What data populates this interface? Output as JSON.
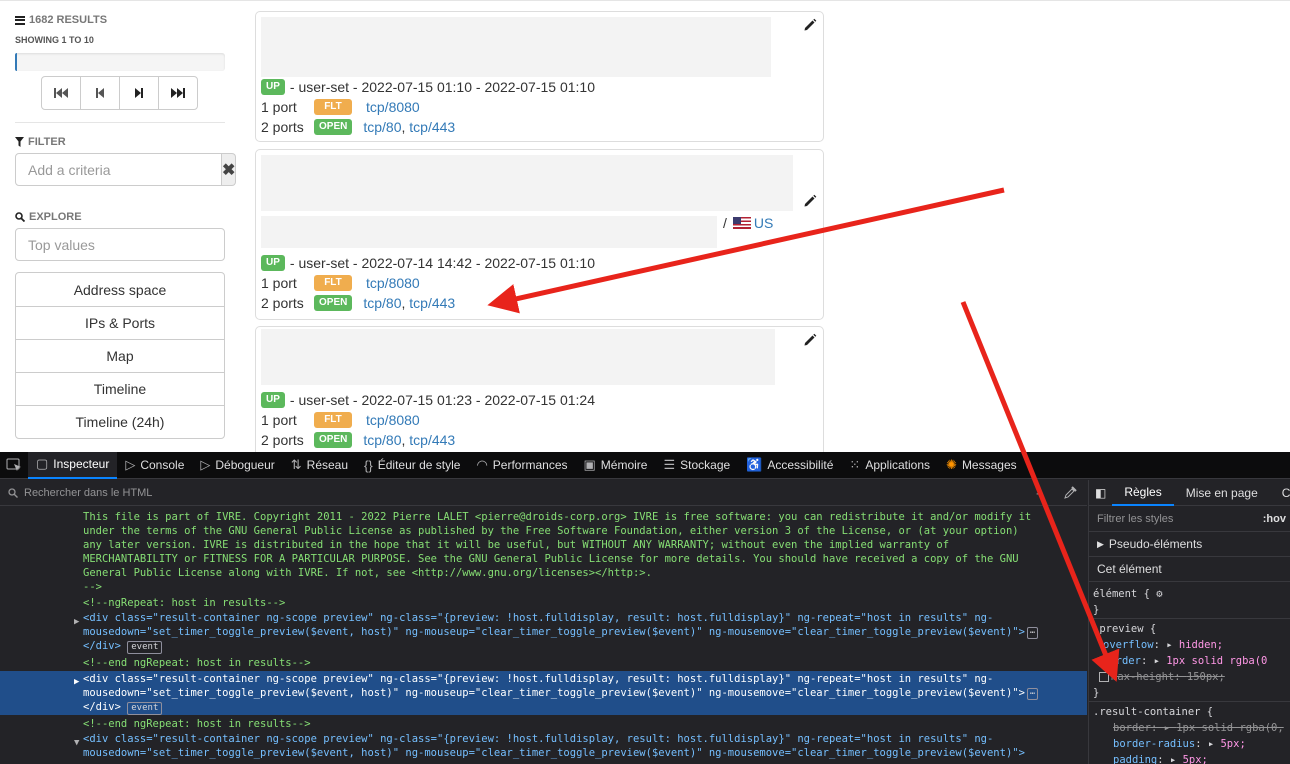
{
  "sidebar": {
    "results_count": "1682 RESULTS",
    "showing": "SHOWING 1 TO 10",
    "progress_fraction": 0.01,
    "pager": [
      "first-page-icon",
      "previous-page-icon",
      "next-page-icon",
      "last-page-icon"
    ],
    "filter": {
      "label": "FILTER",
      "placeholder": "Add a criteria",
      "clear_symbol": "✖"
    },
    "explore": {
      "label": "EXPLORE",
      "placeholder": "Top values"
    },
    "views": [
      "Address space",
      "IPs & Ports",
      "Map",
      "Timeline",
      "Timeline (24h)"
    ]
  },
  "results": [
    {
      "status": "UP",
      "source_line": "- user-set - 2022-07-15 01:10 - 2022-07-15 01:10",
      "ports": [
        {
          "count": "1 port",
          "state": "FLT",
          "links": [
            "tcp/8080"
          ]
        },
        {
          "count": "2 ports",
          "state": "OPEN",
          "links": [
            "tcp/80",
            "tcp/443"
          ]
        }
      ]
    },
    {
      "status": "UP",
      "country": "US",
      "country_sep": "/",
      "source_line": "- user-set - 2022-07-14 14:42 - 2022-07-15 01:10",
      "ports": [
        {
          "count": "1 port",
          "state": "FLT",
          "links": [
            "tcp/8080"
          ]
        },
        {
          "count": "2 ports",
          "state": "OPEN",
          "links": [
            "tcp/80",
            "tcp/443"
          ]
        }
      ]
    },
    {
      "status": "UP",
      "source_line": "- user-set - 2022-07-15 01:23 - 2022-07-15 01:24",
      "ports": [
        {
          "count": "1 port",
          "state": "FLT",
          "links": [
            "tcp/8080"
          ]
        },
        {
          "count": "2 ports",
          "state": "OPEN",
          "links": [
            "tcp/80",
            "tcp/443"
          ]
        }
      ]
    }
  ],
  "devtools": {
    "tabs": [
      {
        "label": "Inspecteur",
        "icon": "inspector-icon",
        "glyph": "▢"
      },
      {
        "label": "Console",
        "icon": "console-icon",
        "glyph": "▷"
      },
      {
        "label": "Débogueur",
        "icon": "debugger-icon",
        "glyph": "▷"
      },
      {
        "label": "Réseau",
        "icon": "network-icon",
        "glyph": "⇅"
      },
      {
        "label": "Éditeur de style",
        "icon": "style-editor-icon",
        "glyph": "{}"
      },
      {
        "label": "Performances",
        "icon": "performance-icon",
        "glyph": "◠"
      },
      {
        "label": "Mémoire",
        "icon": "memory-icon",
        "glyph": "▣"
      },
      {
        "label": "Stockage",
        "icon": "storage-icon",
        "glyph": "☰"
      },
      {
        "label": "Accessibilité",
        "icon": "accessibility-icon",
        "glyph": "♿"
      },
      {
        "label": "Applications",
        "icon": "applications-icon",
        "glyph": "⁙"
      },
      {
        "label": "Messages",
        "icon": "messages-icon",
        "glyph": "✺"
      }
    ],
    "search_placeholder": "Rechercher dans le HTML",
    "markup": {
      "comment_lines": [
        "This file is part of IVRE. Copyright 2011 - 2022 Pierre LALET <pierre@droids-corp.org> IVRE is free software: you can redistribute it and/or modify it",
        "under the terms of the GNU General Public License as published by the Free Software Foundation, either version 3 of the License, or (at your option)",
        "any later version. IVRE is distributed in the hope that it will be useful, but WITHOUT ANY WARRANTY; without even the implied warranty of",
        "MERCHANTABILITY or FITNESS FOR A PARTICULAR PURPOSE. See the GNU General Public License for more details. You should have received a copy of the GNU",
        "General Public License along with IVRE. If not, see <http://www.gnu.org/licenses></http:>.",
        "-->"
      ],
      "ng_repeat_comment": "<!--ngRepeat: host in results-->",
      "end_ng_repeat_comment": "<!--end ngRepeat: host in results-->",
      "div_line1": "<div class=\"result-container ng-scope preview\" ng-class=\"{preview: !host.fulldisplay, result: host.fulldisplay}\" ng-repeat=\"host in results\" ng-",
      "div_line2": "mousedown=\"set_timer_toggle_preview($event, host)\" ng-mouseup=\"clear_timer_toggle_preview($event)\" ng-mousemove=\"clear_timer_toggle_preview($event)\">",
      "close_div": "</div>",
      "event_badge": "event"
    },
    "rules": {
      "tabs": [
        "Règles",
        "Mise en page",
        "Ca"
      ],
      "filter_placeholder": "Filtrer les styles",
      "hov": ":hov",
      "pseudo": "Pseudo-éléments",
      "this_element": "Cet élément",
      "element_open": "élément {",
      "close_brace": "}",
      "preview_selector": ".preview {",
      "preview_props": [
        {
          "name": "overflow",
          "value": "hidden;"
        },
        {
          "name": "border",
          "value": "1px solid rgba(0"
        },
        {
          "name": "max-height",
          "value": "150px;"
        }
      ],
      "container_selector": ".result-container {",
      "container_props": [
        {
          "name": "border",
          "value": "1px solid rgba(0,"
        },
        {
          "name": "border-radius",
          "value": "5px;"
        },
        {
          "name": "padding",
          "value": "5px;"
        }
      ]
    }
  },
  "colors": {
    "annotation_arrow": "#e8241b",
    "accent": "#0a84ff",
    "label_green": "#5cb85c",
    "label_orange": "#f0ad4e",
    "link": "#337ab7"
  }
}
